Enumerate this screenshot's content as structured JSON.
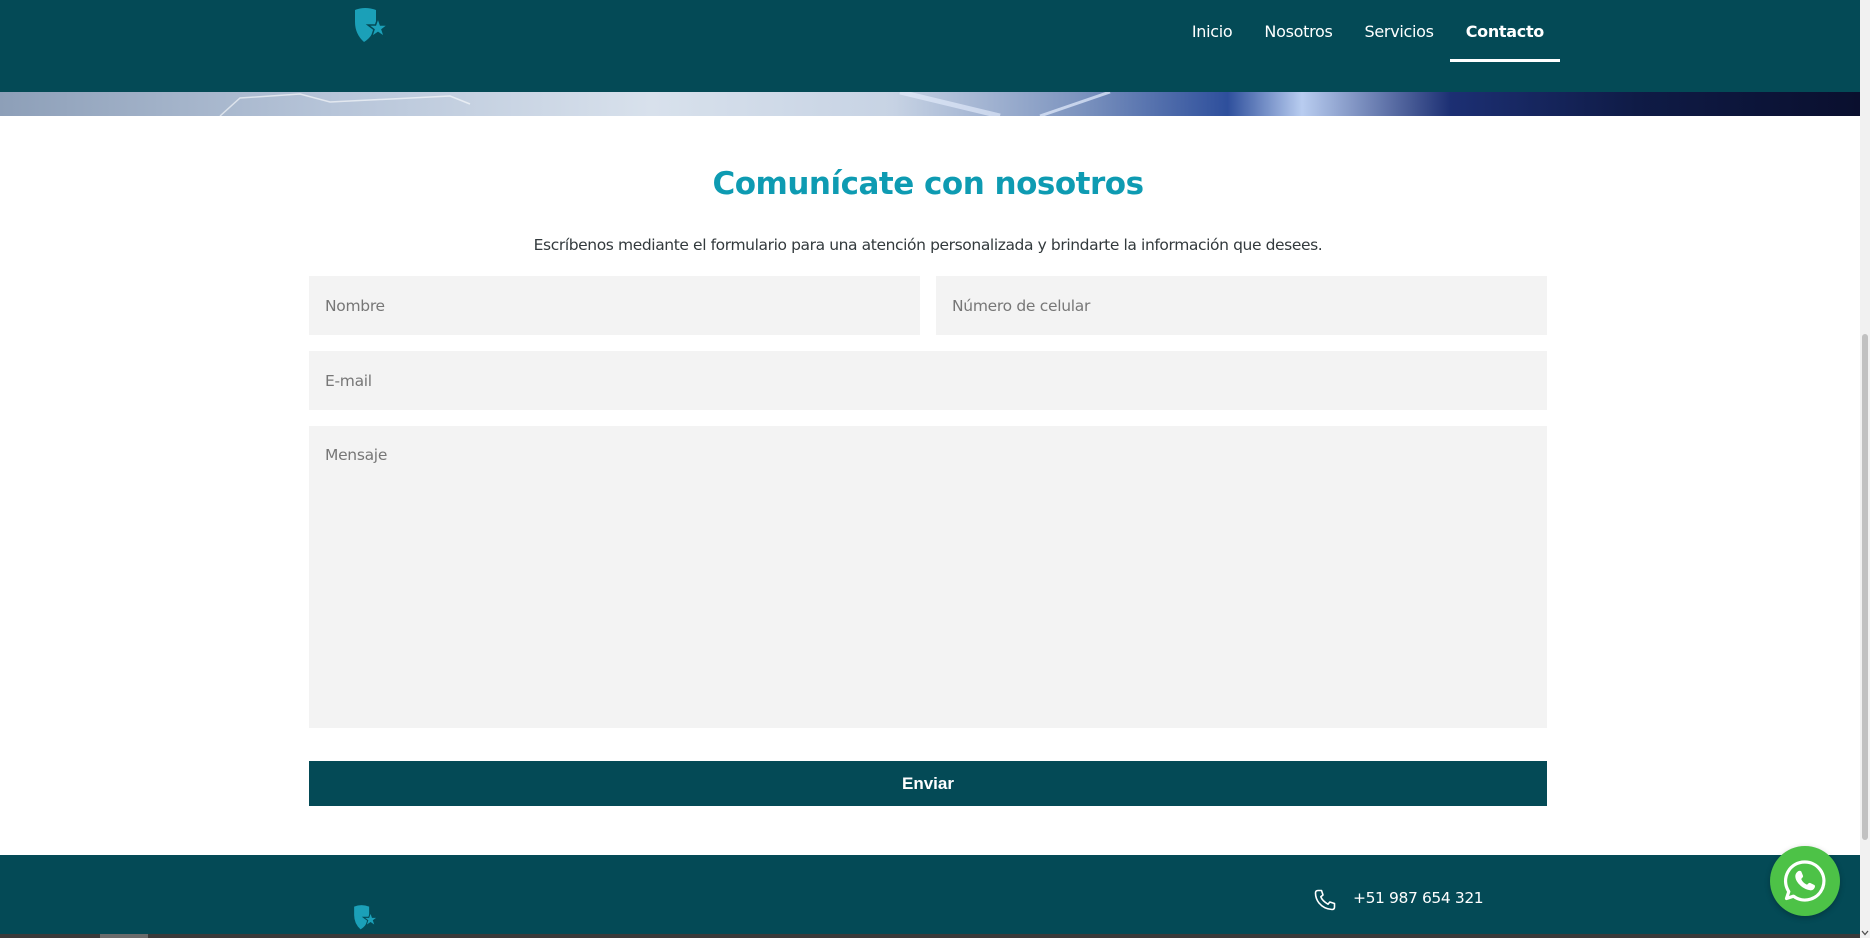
{
  "header": {
    "logo_icon": "shield-star-icon",
    "nav": [
      {
        "label": "Inicio",
        "active": false
      },
      {
        "label": "Nosotros",
        "active": false
      },
      {
        "label": "Servicios",
        "active": false
      },
      {
        "label": "Contacto",
        "active": true
      }
    ]
  },
  "contact": {
    "title": "Comunícate con nosotros",
    "subtitle": "Escríbenos mediante el formulario para una atención personalizada y brindarte la información que desees.",
    "fields": {
      "nombre_placeholder": "Nombre",
      "celular_placeholder": "Número de celular",
      "email_placeholder": "E-mail",
      "mensaje_placeholder": "Mensaje"
    },
    "submit_label": "Enviar"
  },
  "footer": {
    "phone": "+51 987 654 321",
    "phone_icon": "phone-icon",
    "logo_icon": "shield-star-icon"
  },
  "whatsapp": {
    "icon": "whatsapp-icon"
  },
  "colors": {
    "primary_dark": "#044a56",
    "accent_teal": "#0e9bb2",
    "field_bg": "#f3f3f3",
    "whatsapp_green": "#4dc247"
  }
}
